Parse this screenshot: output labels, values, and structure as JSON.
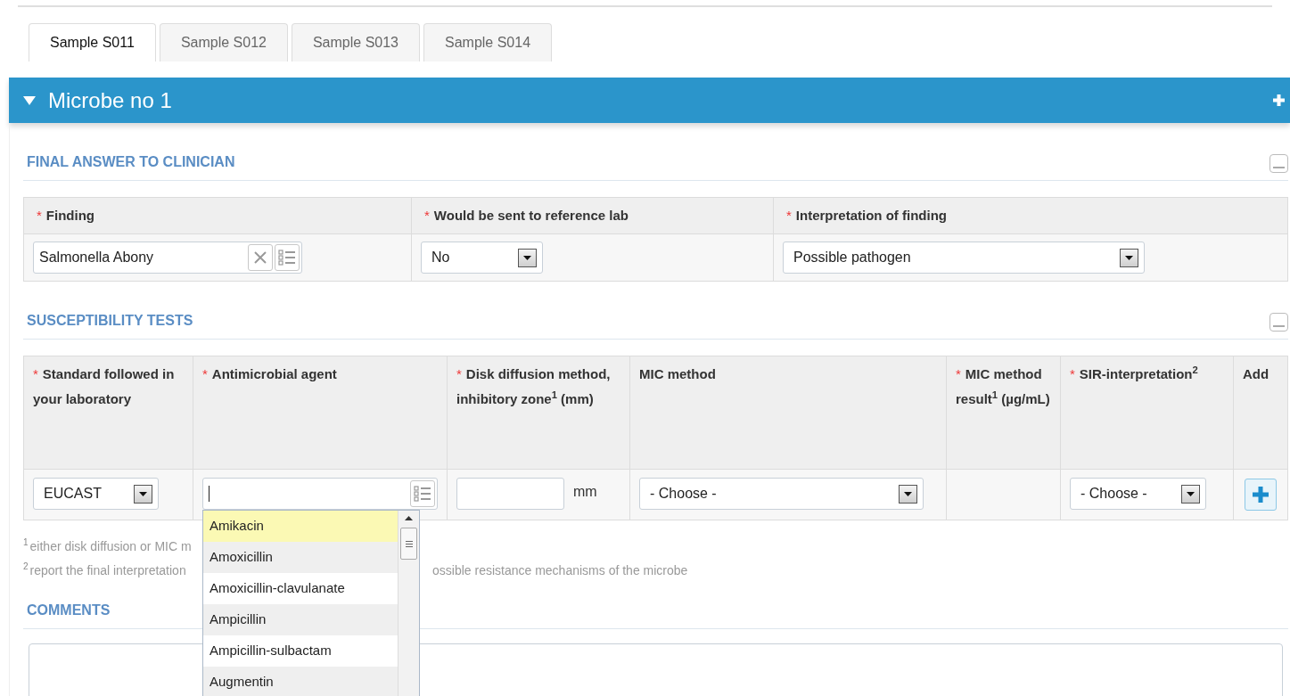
{
  "tabs": [
    {
      "label": "Sample S011",
      "selected": true
    },
    {
      "label": "Sample S012",
      "selected": false
    },
    {
      "label": "Sample S013",
      "selected": false
    },
    {
      "label": "Sample S014",
      "selected": false
    }
  ],
  "panel": {
    "title": "Microbe no 1",
    "expanded": true
  },
  "final_answer": {
    "title": "FINAL ANSWER TO CLINICIAN",
    "columns": [
      {
        "mark": "*",
        "label": "Finding"
      },
      {
        "mark": "*",
        "label": "Would be sent to reference lab"
      },
      {
        "mark": "*",
        "label": "Interpretation of finding"
      }
    ],
    "finding": {
      "value": "Salmonella Abony"
    },
    "reference_lab": {
      "value": "No"
    },
    "interpretation": {
      "value": "Possible pathogen"
    }
  },
  "susceptibility": {
    "title": "SUSCEPTIBILITY TESTS",
    "columns": [
      {
        "mark": "*",
        "label": "Standard followed in your laboratory"
      },
      {
        "mark": "*",
        "label": "Antimicrobial agent"
      },
      {
        "mark": "*",
        "label": "Disk diffusion method, inhibitory zone$^{1}$ (mm)"
      },
      {
        "label": "MIC method"
      },
      {
        "mark": "*",
        "label": "MIC method result$^{1}$ (µg/mL)"
      },
      {
        "mark": "*",
        "label": "SIR-interpretation$^{2}$"
      },
      {
        "label": "Add"
      }
    ],
    "standard": {
      "value": "EUCAST"
    },
    "zone_unit": "mm",
    "mic_method": {
      "value": "- Choose -"
    },
    "sir": {
      "value": "- Choose -"
    },
    "agent_options": [
      {
        "label": "Amikacin",
        "selected": true
      },
      {
        "label": "Amoxicillin",
        "selected": false
      },
      {
        "label": "Amoxicillin-clavulanate",
        "selected": false
      },
      {
        "label": "Ampicillin",
        "selected": false
      },
      {
        "label": "Ampicillin-sulbactam",
        "selected": false
      },
      {
        "label": "Augmentin",
        "selected": false
      }
    ],
    "footnotes": [
      {
        "mark": "1",
        "before": "either disk diffusion or MIC m"
      },
      {
        "mark": "2",
        "before": "report the final interpretation",
        "after": "ossible resistance mechanisms of the microbe"
      }
    ]
  },
  "comments": {
    "title": "COMMENTS"
  }
}
